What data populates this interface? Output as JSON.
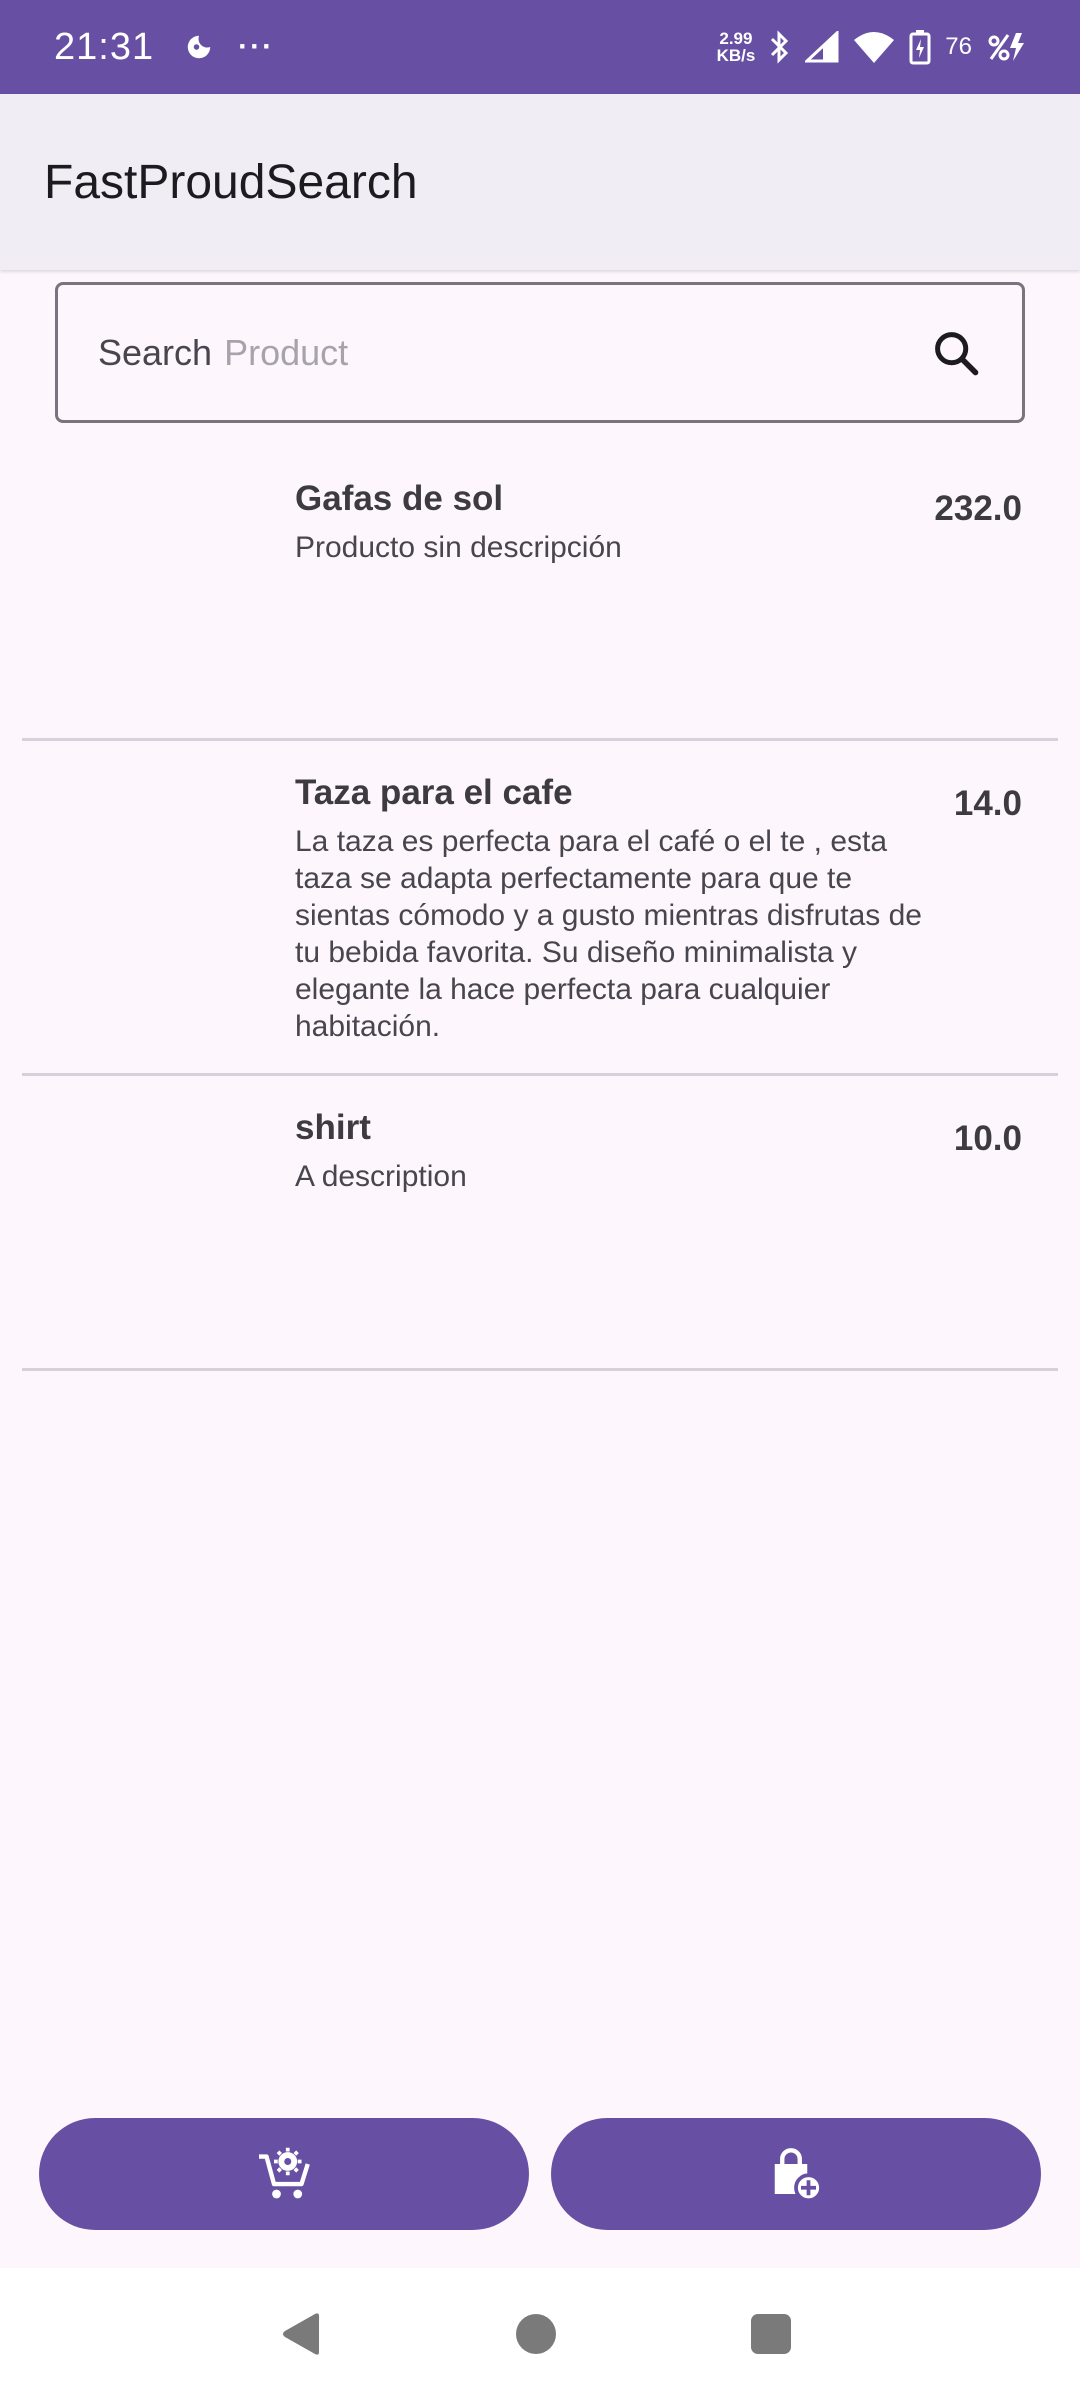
{
  "status_bar": {
    "time": "21:31",
    "dots": "···",
    "net_speed_value": "2.99",
    "net_speed_unit": "KB/s",
    "battery_level": "76",
    "icons": [
      "moon-icon",
      "bluetooth-icon",
      "signal-icon",
      "wifi-icon",
      "battery-icon",
      "charging-icon"
    ]
  },
  "app_bar": {
    "title": "FastProudSearch"
  },
  "search": {
    "label": "Search",
    "placeholder": "Product",
    "value": ""
  },
  "products": [
    {
      "name": "Gafas de sol",
      "description": "Producto sin descripción",
      "price": "232.0"
    },
    {
      "name": "Taza para el cafe",
      "description": "La taza es perfecta para el café o el te , esta taza se adapta perfectamente para que te sientas cómodo y a gusto mientras disfrutas de tu bebida favorita. Su diseño minimalista y elegante la hace perfecta para cualquier habitación.",
      "price": "14.0"
    },
    {
      "name": "shirt",
      "description": "A description",
      "price": "10.0"
    }
  ],
  "bottom_buttons": [
    {
      "icon": "cart-settings-icon"
    },
    {
      "icon": "add-shopping-bag-icon"
    }
  ],
  "nav_bar": {
    "icons": [
      "back-icon",
      "home-icon",
      "recents-icon"
    ]
  },
  "colors": {
    "primary": "#6750a4",
    "background": "#fdf7fd",
    "app_bar": "#f1edf4",
    "divider": "#d6d1da"
  }
}
